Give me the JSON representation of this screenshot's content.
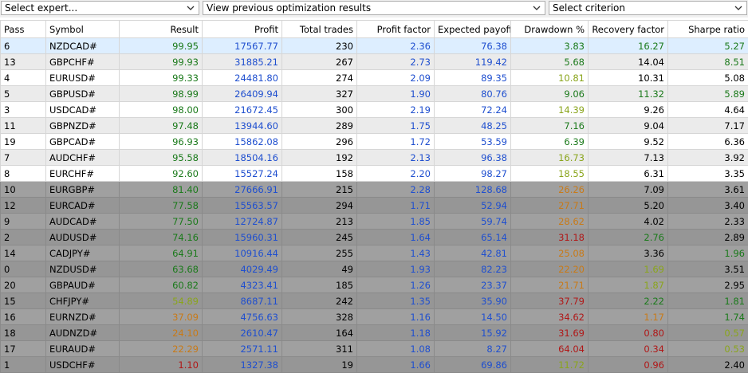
{
  "toolbar": {
    "expert_select": "Select expert...",
    "results_select": "View previous optimization results",
    "criterion_select": "Select criterion"
  },
  "colors": {
    "green": "#1b7a1b",
    "blue": "#1f4fcf",
    "yellowgreen": "#8aa51c",
    "orange": "#c87a18",
    "red": "#b01818"
  },
  "columns": [
    "Pass",
    "Symbol",
    "Result",
    "Profit",
    "Total trades",
    "Profit factor",
    "Expected payoff",
    "Drawdown %",
    "Recovery factor",
    "Sharpe ratio"
  ],
  "rows": [
    {
      "pass": "6",
      "symbol": "NZDCAD#",
      "result": "99.95",
      "profit": "17567.77",
      "trades": "230",
      "pf": "2.36",
      "ep": "76.38",
      "dd": "3.83",
      "rf": "16.27",
      "sr": "5.27",
      "rc": "green",
      "ddc": "green",
      "rfc": "green",
      "src": "green"
    },
    {
      "pass": "13",
      "symbol": "GBPCHF#",
      "result": "99.93",
      "profit": "31885.21",
      "trades": "267",
      "pf": "2.73",
      "ep": "119.42",
      "dd": "5.68",
      "rf": "14.04",
      "sr": "8.51",
      "rc": "green",
      "ddc": "green",
      "rfc": "black",
      "src": "green"
    },
    {
      "pass": "4",
      "symbol": "EURUSD#",
      "result": "99.33",
      "profit": "24481.80",
      "trades": "274",
      "pf": "2.09",
      "ep": "89.35",
      "dd": "10.81",
      "rf": "10.31",
      "sr": "5.08",
      "rc": "green",
      "ddc": "yellowgreen",
      "rfc": "black",
      "src": "black"
    },
    {
      "pass": "5",
      "symbol": "GBPUSD#",
      "result": "98.99",
      "profit": "26409.94",
      "trades": "327",
      "pf": "1.90",
      "ep": "80.76",
      "dd": "9.06",
      "rf": "11.32",
      "sr": "5.89",
      "rc": "green",
      "ddc": "green",
      "rfc": "green",
      "src": "green"
    },
    {
      "pass": "3",
      "symbol": "USDCAD#",
      "result": "98.00",
      "profit": "21672.45",
      "trades": "300",
      "pf": "2.19",
      "ep": "72.24",
      "dd": "14.39",
      "rf": "9.26",
      "sr": "4.64",
      "rc": "green",
      "ddc": "yellowgreen",
      "rfc": "black",
      "src": "black"
    },
    {
      "pass": "11",
      "symbol": "GBPNZD#",
      "result": "97.48",
      "profit": "13944.60",
      "trades": "289",
      "pf": "1.75",
      "ep": "48.25",
      "dd": "7.16",
      "rf": "9.04",
      "sr": "7.17",
      "rc": "green",
      "ddc": "green",
      "rfc": "black",
      "src": "black"
    },
    {
      "pass": "19",
      "symbol": "GBPCAD#",
      "result": "96.93",
      "profit": "15862.08",
      "trades": "296",
      "pf": "1.72",
      "ep": "53.59",
      "dd": "6.39",
      "rf": "9.52",
      "sr": "6.36",
      "rc": "green",
      "ddc": "green",
      "rfc": "black",
      "src": "black"
    },
    {
      "pass": "7",
      "symbol": "AUDCHF#",
      "result": "95.58",
      "profit": "18504.16",
      "trades": "192",
      "pf": "2.13",
      "ep": "96.38",
      "dd": "16.73",
      "rf": "7.13",
      "sr": "3.92",
      "rc": "green",
      "ddc": "yellowgreen",
      "rfc": "black",
      "src": "black"
    },
    {
      "pass": "8",
      "symbol": "EURCHF#",
      "result": "92.60",
      "profit": "15527.24",
      "trades": "158",
      "pf": "2.20",
      "ep": "98.27",
      "dd": "18.55",
      "rf": "6.31",
      "sr": "3.35",
      "rc": "green",
      "ddc": "yellowgreen",
      "rfc": "black",
      "src": "black"
    },
    {
      "pass": "10",
      "symbol": "EURGBP#",
      "result": "81.40",
      "profit": "27666.91",
      "trades": "215",
      "pf": "2.28",
      "ep": "128.68",
      "dd": "26.26",
      "rf": "7.09",
      "sr": "3.61",
      "rc": "green",
      "ddc": "orange",
      "rfc": "black",
      "src": "black"
    },
    {
      "pass": "12",
      "symbol": "EURCAD#",
      "result": "77.58",
      "profit": "15563.57",
      "trades": "294",
      "pf": "1.71",
      "ep": "52.94",
      "dd": "27.71",
      "rf": "5.20",
      "sr": "3.40",
      "rc": "green",
      "ddc": "orange",
      "rfc": "black",
      "src": "black"
    },
    {
      "pass": "9",
      "symbol": "AUDCAD#",
      "result": "77.50",
      "profit": "12724.87",
      "trades": "213",
      "pf": "1.85",
      "ep": "59.74",
      "dd": "28.62",
      "rf": "4.02",
      "sr": "2.33",
      "rc": "green",
      "ddc": "orange",
      "rfc": "black",
      "src": "black"
    },
    {
      "pass": "2",
      "symbol": "AUDUSD#",
      "result": "74.16",
      "profit": "15960.31",
      "trades": "245",
      "pf": "1.64",
      "ep": "65.14",
      "dd": "31.18",
      "rf": "2.76",
      "sr": "2.89",
      "rc": "green",
      "ddc": "red",
      "rfc": "green",
      "src": "black"
    },
    {
      "pass": "14",
      "symbol": "CADJPY#",
      "result": "64.91",
      "profit": "10916.44",
      "trades": "255",
      "pf": "1.43",
      "ep": "42.81",
      "dd": "25.08",
      "rf": "3.36",
      "sr": "1.96",
      "rc": "green",
      "ddc": "orange",
      "rfc": "black",
      "src": "green"
    },
    {
      "pass": "0",
      "symbol": "NZDUSD#",
      "result": "63.68",
      "profit": "4029.49",
      "trades": "49",
      "pf": "1.93",
      "ep": "82.23",
      "dd": "22.20",
      "rf": "1.69",
      "sr": "3.51",
      "rc": "green",
      "ddc": "orange",
      "rfc": "yellowgreen",
      "src": "black"
    },
    {
      "pass": "20",
      "symbol": "GBPAUD#",
      "result": "60.82",
      "profit": "4323.41",
      "trades": "185",
      "pf": "1.26",
      "ep": "23.37",
      "dd": "21.71",
      "rf": "1.87",
      "sr": "2.95",
      "rc": "green",
      "ddc": "orange",
      "rfc": "yellowgreen",
      "src": "black"
    },
    {
      "pass": "15",
      "symbol": "CHFJPY#",
      "result": "54.89",
      "profit": "8687.11",
      "trades": "242",
      "pf": "1.35",
      "ep": "35.90",
      "dd": "37.79",
      "rf": "2.22",
      "sr": "1.81",
      "rc": "yellowgreen",
      "ddc": "red",
      "rfc": "green",
      "src": "green"
    },
    {
      "pass": "16",
      "symbol": "EURNZD#",
      "result": "37.09",
      "profit": "4756.63",
      "trades": "328",
      "pf": "1.16",
      "ep": "14.50",
      "dd": "34.62",
      "rf": "1.17",
      "sr": "1.74",
      "rc": "orange",
      "ddc": "red",
      "rfc": "orange",
      "src": "green"
    },
    {
      "pass": "18",
      "symbol": "AUDNZD#",
      "result": "24.10",
      "profit": "2610.47",
      "trades": "164",
      "pf": "1.18",
      "ep": "15.92",
      "dd": "31.69",
      "rf": "0.80",
      "sr": "0.57",
      "rc": "orange",
      "ddc": "red",
      "rfc": "red",
      "src": "yellowgreen"
    },
    {
      "pass": "17",
      "symbol": "EURAUD#",
      "result": "22.29",
      "profit": "2571.11",
      "trades": "311",
      "pf": "1.08",
      "ep": "8.27",
      "dd": "64.04",
      "rf": "0.34",
      "sr": "0.53",
      "rc": "orange",
      "ddc": "red",
      "rfc": "red",
      "src": "yellowgreen"
    },
    {
      "pass": "1",
      "symbol": "USDCHF#",
      "result": "1.10",
      "profit": "1327.38",
      "trades": "19",
      "pf": "1.66",
      "ep": "69.86",
      "dd": "11.72",
      "rf": "0.96",
      "sr": "2.40",
      "rc": "red",
      "ddc": "yellowgreen",
      "rfc": "red",
      "src": "black"
    }
  ]
}
